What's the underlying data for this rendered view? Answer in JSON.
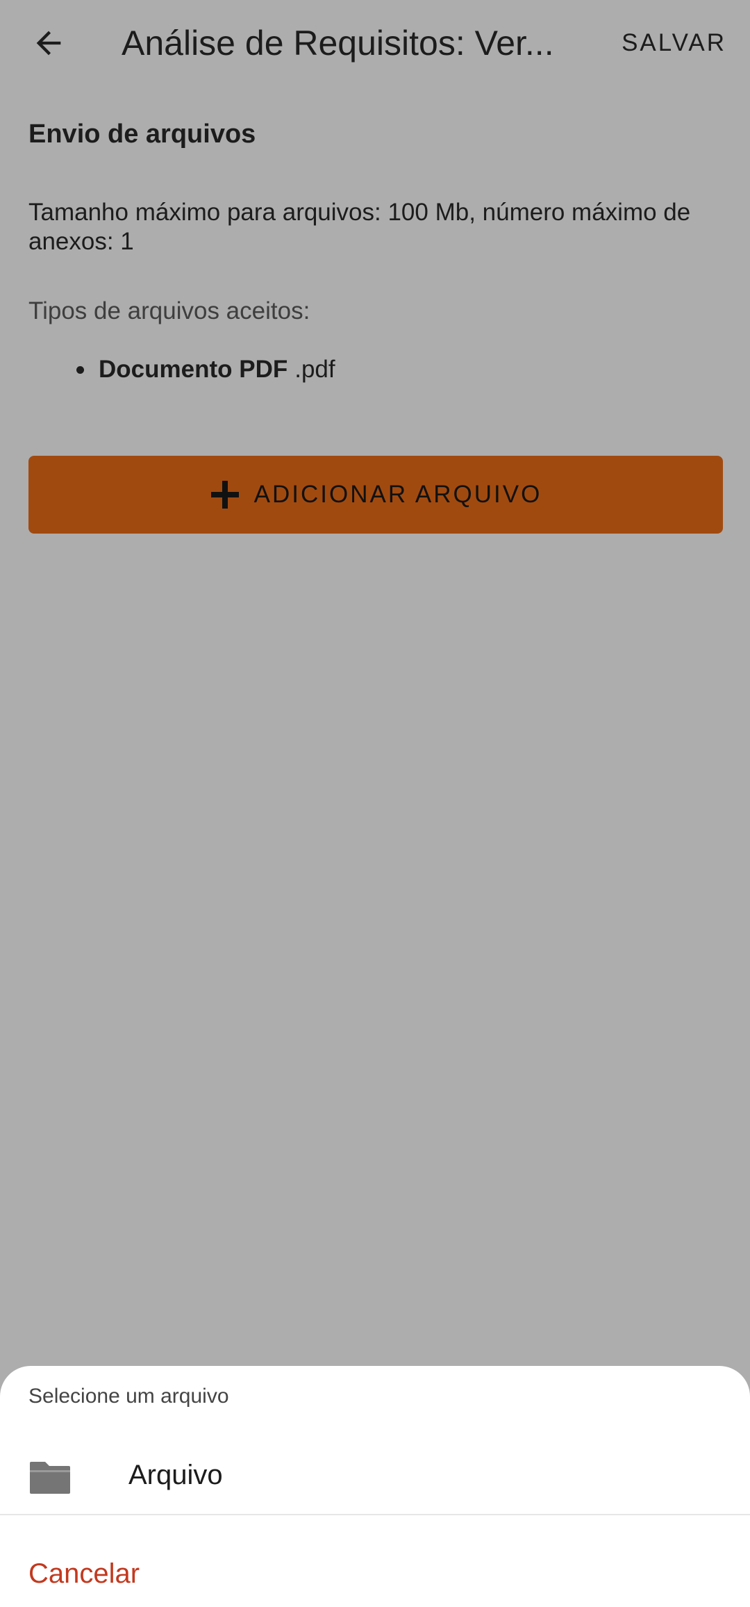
{
  "appbar": {
    "back_icon": "arrow-left-icon",
    "title": "Análise de Requisitos: Ver...",
    "save_label": "SALVAR"
  },
  "upload": {
    "section_title": "Envio de arquivos",
    "limits_text": "Tamanho máximo para arquivos: 100 Mb, número máximo de anexos: 1",
    "types_label": "Tipos de arquivos aceitos:",
    "types": [
      {
        "name": "Documento PDF",
        "extension": ".pdf"
      }
    ],
    "add_button": {
      "icon": "plus-icon",
      "label": "ADICIONAR ARQUIVO",
      "color": "#a14a10"
    }
  },
  "sheet": {
    "title": "Selecione um arquivo",
    "options": [
      {
        "icon": "folder-icon",
        "label": "Arquivo"
      }
    ],
    "cancel_label": "Cancelar",
    "cancel_color": "#c2391f"
  }
}
